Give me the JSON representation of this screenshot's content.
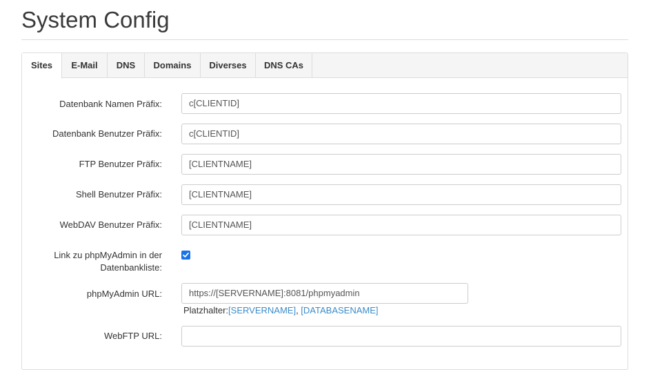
{
  "page": {
    "title": "System Config"
  },
  "tabs": [
    {
      "label": "Sites",
      "active": true
    },
    {
      "label": "E-Mail",
      "active": false
    },
    {
      "label": "DNS",
      "active": false
    },
    {
      "label": "Domains",
      "active": false
    },
    {
      "label": "Diverses",
      "active": false
    },
    {
      "label": "DNS CAs",
      "active": false
    }
  ],
  "form": {
    "db_name_prefix": {
      "label": "Datenbank Namen Präfix:",
      "value": "c[CLIENTID]"
    },
    "db_user_prefix": {
      "label": "Datenbank Benutzer Präfix:",
      "value": "c[CLIENTID]"
    },
    "ftp_user_prefix": {
      "label": "FTP Benutzer Präfix:",
      "value": "[CLIENTNAME]"
    },
    "shell_user_prefix": {
      "label": "Shell Benutzer Präfix:",
      "value": "[CLIENTNAME]"
    },
    "webdav_user_prefix": {
      "label": "WebDAV Benutzer Präfix:",
      "value": "[CLIENTNAME]"
    },
    "phpmyadmin_link": {
      "label_line1": "Link zu phpMyAdmin in der",
      "label_line2": "Datenbankliste:",
      "checked": true
    },
    "phpmyadmin_url": {
      "label": "phpMyAdmin URL:",
      "value": "https://[SERVERNAME]:8081/phpmyadmin",
      "hint_prefix": "Platzhalter:",
      "placeholder_1": "[SERVERNAME]",
      "separator": ", ",
      "placeholder_2": "[DATABASENAME]"
    },
    "webftp_url": {
      "label": "WebFTP URL:",
      "value": ""
    }
  },
  "colors": {
    "checkbox": "#1a73e8",
    "placeholder_link": "#3a8bc8"
  }
}
